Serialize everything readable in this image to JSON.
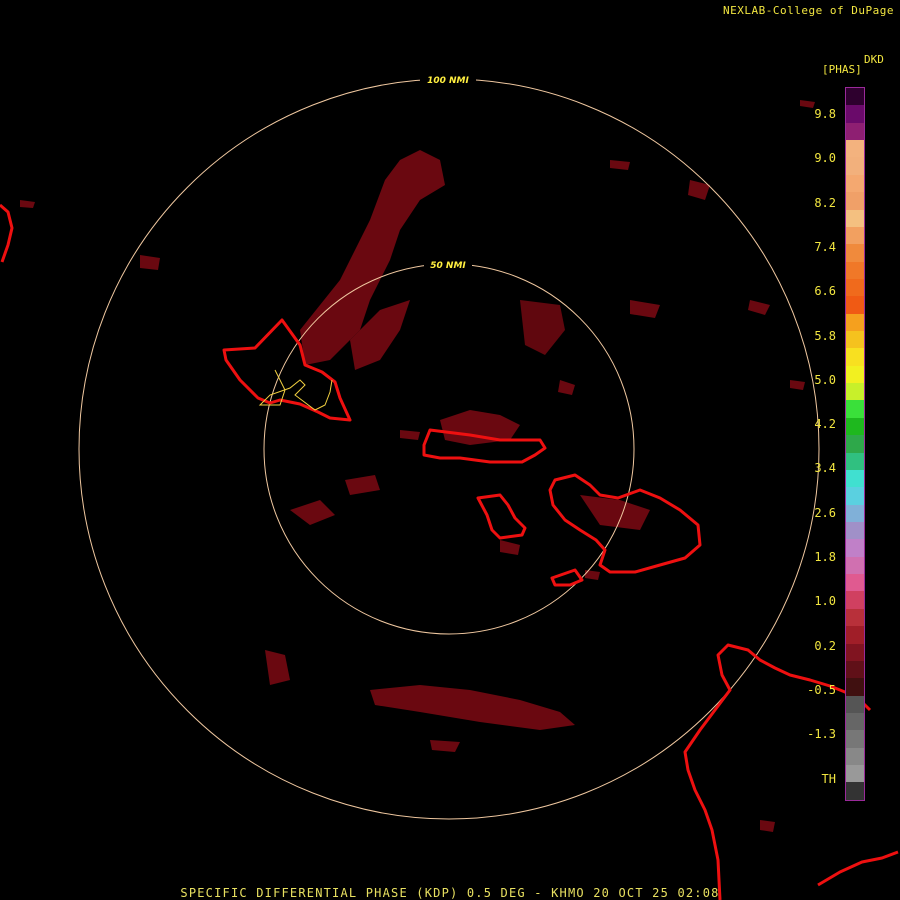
{
  "header": {
    "credit": "NEXLAB-College of DuPage"
  },
  "legend": {
    "units_top": "DKD",
    "units_name": "[PHAS]",
    "ticks": [
      "9.8",
      "9.0",
      "8.2",
      "7.4",
      "6.6",
      "5.8",
      "5.0",
      "4.2",
      "3.4",
      "2.6",
      "1.8",
      "1.0",
      "0.2",
      "-0.5",
      "-1.3",
      "TH"
    ],
    "colors": [
      "#2e002e",
      "#6a0a6a",
      "#8e1f72",
      "#f3b27e",
      "#f2b07c",
      "#f4a870",
      "#f0a068",
      "#f4c080",
      "#f2a060",
      "#f08a3c",
      "#f07828",
      "#f06a1c",
      "#f05a14",
      "#f5a01e",
      "#f5c21e",
      "#f8e020",
      "#f2f020",
      "#c8f02a",
      "#3ae03a",
      "#1eb81e",
      "#2ea84a",
      "#30c080",
      "#40e0d0",
      "#5ad0e0",
      "#80b0d8",
      "#a090c8",
      "#c080c8",
      "#d070b0",
      "#e05a90",
      "#d04060",
      "#b8303a",
      "#a01e28",
      "#801420",
      "#601018",
      "#401010",
      "#555555",
      "#666666",
      "#777777",
      "#888888",
      "#999999",
      "#333333"
    ]
  },
  "map": {
    "rings": [
      {
        "label": "100 NMI"
      },
      {
        "label": "50 NMI"
      }
    ]
  },
  "footer": {
    "text": "SPECIFIC DIFFERENTIAL PHASE (KDP) 0.5 DEG - KHMO 20 OCT 25 02:08"
  }
}
